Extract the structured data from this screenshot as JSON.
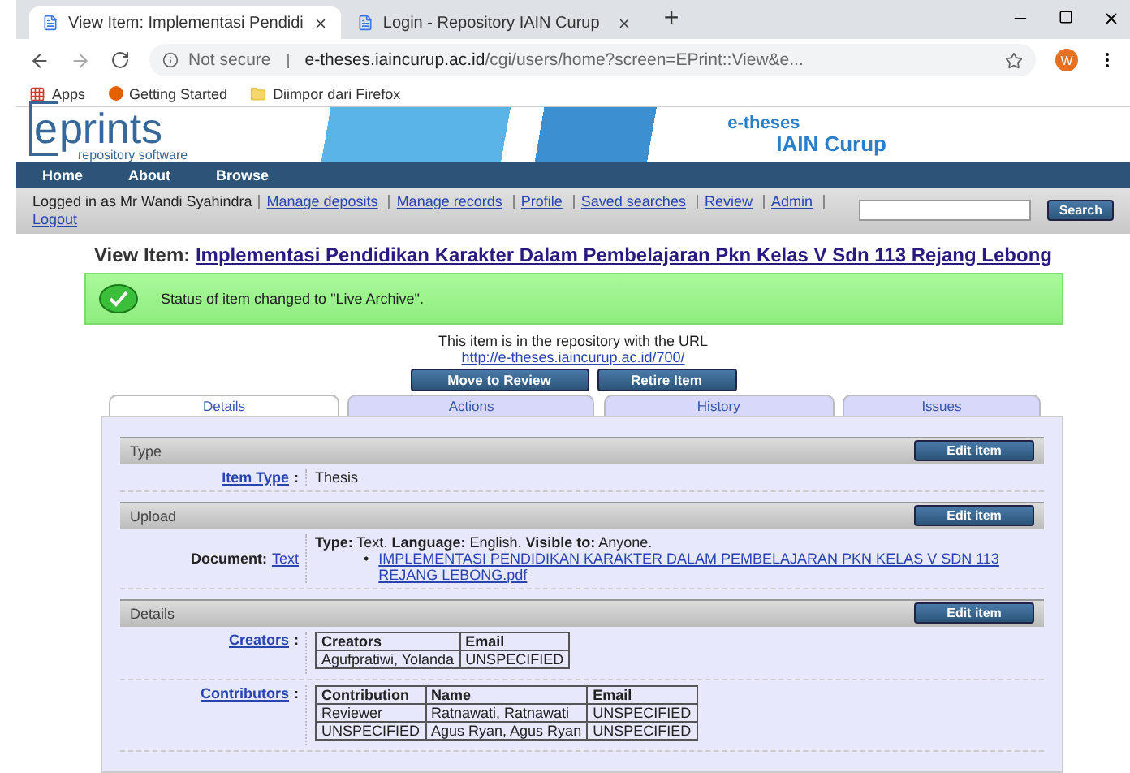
{
  "browser": {
    "tabs": [
      {
        "title": "View Item: Implementasi Pendidi",
        "selected": true
      },
      {
        "title": "Login - Repository IAIN Curup",
        "selected": false
      }
    ],
    "new_tab": "+",
    "address": {
      "security": "Not secure",
      "host": "e-theses.iaincurup.ac.id",
      "path": "/cgi/users/home?screen=EPrint::View&e..."
    },
    "profile_initial": "W",
    "bookmarks": [
      {
        "label": "Apps",
        "kind": "apps"
      },
      {
        "label": "Getting Started",
        "kind": "firefox"
      },
      {
        "label": "Diimpor dari Firefox",
        "kind": "folder"
      }
    ]
  },
  "site": {
    "logo": {
      "boxed": "e",
      "rest": "prints",
      "sub": "repository software"
    },
    "banner_title": {
      "line1": "e-theses",
      "line2": "IAIN Curup"
    },
    "nav": [
      "Home",
      "About",
      "Browse"
    ],
    "login_bar": {
      "logged_in": "Logged in as Mr Wandi Syahindra",
      "links": [
        "Manage deposits",
        "Manage records",
        "Profile",
        "Saved searches",
        "Review",
        "Admin",
        "Logout"
      ]
    },
    "search_button": "Search"
  },
  "page": {
    "title_prefix": "View Item:",
    "title": "Implementasi Pendidikan Karakter Dalam Pembelajaran Pkn Kelas V Sdn 113 Rejang Lebong",
    "status_message": "Status of item changed to \"Live Archive\".",
    "url_intro": "This item is in the repository with the URL",
    "url": "http://e-theses.iaincurup.ac.id/700/",
    "action_buttons": [
      "Move to Review",
      "Retire Item"
    ],
    "tabs": [
      {
        "label": "Details",
        "selected": true
      },
      {
        "label": "Actions",
        "selected": false
      },
      {
        "label": "History",
        "selected": false
      },
      {
        "label": "Issues",
        "selected": false
      }
    ],
    "sections": [
      {
        "heading": "Type",
        "edit_button": "Edit item",
        "rows": [
          {
            "kind": "text",
            "label_link": "Item Type",
            "colon": ":",
            "value": "Thesis"
          }
        ]
      },
      {
        "heading": "Upload",
        "edit_button": "Edit item",
        "rows": [
          {
            "kind": "upload",
            "label_plain": "Document:",
            "label_link": "Text",
            "bullet": "•",
            "description": "**Type:** Text. **Language:** English. **Visible to:** Anyone.",
            "files": [
              "IMPLEMENTASI PENDIDIKAN KARAKTER DALAM PEMBELAJARAN PKN KELAS V SDN 113 REJANG LEBONG.pdf"
            ]
          }
        ]
      },
      {
        "heading": "Details",
        "edit_button": "Edit item",
        "rows": [
          {
            "kind": "table",
            "label_link": "Creators",
            "colon": ":",
            "columns": [
              "Creators",
              "Email"
            ],
            "rows": [
              [
                "Agufpratiwi, Yolanda",
                "UNSPECIFIED"
              ]
            ]
          },
          {
            "kind": "table",
            "label_link": "Contributors",
            "colon": ":",
            "columns": [
              "Contribution",
              "Name",
              "Email"
            ],
            "rows": [
              [
                "Reviewer",
                "Ratnawati, Ratnawati",
                "UNSPECIFIED"
              ],
              [
                "UNSPECIFIED",
                "Agus Ryan, Agus Ryan",
                "UNSPECIFIED"
              ]
            ]
          }
        ]
      }
    ]
  }
}
